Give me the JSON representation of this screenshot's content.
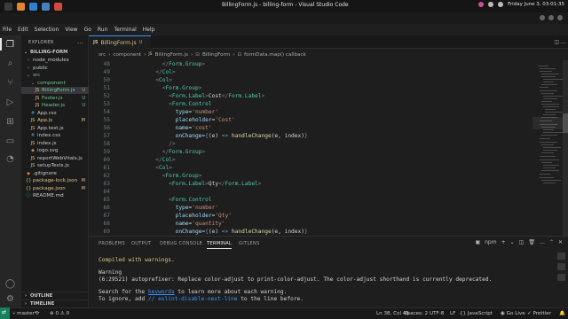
{
  "system": {
    "window_title": "BillingForm.js - billing-form - Visual Studio Code",
    "clock": "Friday June 3, 03:01:35"
  },
  "menu": [
    "File",
    "Edit",
    "Selection",
    "View",
    "Go",
    "Run",
    "Terminal",
    "Help"
  ],
  "explorer": {
    "title": "EXPLORER",
    "project": "BILLING-FORM",
    "items": [
      {
        "label": "node_modules",
        "kind": "folder",
        "depth": 1,
        "badge": "",
        "color": "#cccccc"
      },
      {
        "label": "public",
        "kind": "folder",
        "depth": 1,
        "badge": "",
        "color": "#cccccc"
      },
      {
        "label": "src",
        "kind": "folder-open",
        "depth": 1,
        "badge": "",
        "color": "#73c991"
      },
      {
        "label": "component",
        "kind": "folder-open",
        "depth": 2,
        "badge": "",
        "color": "#73c991"
      },
      {
        "label": "BillingForm.js",
        "kind": "js",
        "depth": 3,
        "badge": "U",
        "color": "#73c991",
        "selected": true
      },
      {
        "label": "Footer.js",
        "kind": "js",
        "depth": 3,
        "badge": "U",
        "color": "#73c991"
      },
      {
        "label": "Header.js",
        "kind": "js",
        "depth": 3,
        "badge": "U",
        "color": "#73c991"
      },
      {
        "label": "App.css",
        "kind": "css",
        "depth": 2,
        "badge": "",
        "color": "#cccccc"
      },
      {
        "label": "App.js",
        "kind": "js",
        "depth": 2,
        "badge": "M",
        "color": "#e2c08d"
      },
      {
        "label": "App.test.js",
        "kind": "js",
        "depth": 2,
        "badge": "",
        "color": "#cccccc"
      },
      {
        "label": "index.css",
        "kind": "css",
        "depth": 2,
        "badge": "",
        "color": "#cccccc"
      },
      {
        "label": "index.js",
        "kind": "js",
        "depth": 2,
        "badge": "",
        "color": "#cccccc"
      },
      {
        "label": "logo.svg",
        "kind": "svg",
        "depth": 2,
        "badge": "",
        "color": "#cccccc"
      },
      {
        "label": "reportWebVitals.js",
        "kind": "js",
        "depth": 2,
        "badge": "",
        "color": "#cccccc"
      },
      {
        "label": "setupTests.js",
        "kind": "js",
        "depth": 2,
        "badge": "",
        "color": "#cccccc"
      },
      {
        "label": ".gitignore",
        "kind": "git",
        "depth": 1,
        "badge": "",
        "color": "#cccccc"
      },
      {
        "label": "package-lock.json",
        "kind": "json",
        "depth": 1,
        "badge": "M",
        "color": "#e2c08d"
      },
      {
        "label": "package.json",
        "kind": "json",
        "depth": 1,
        "badge": "M",
        "color": "#e2c08d"
      },
      {
        "label": "README.md",
        "kind": "md",
        "depth": 1,
        "badge": "",
        "color": "#cccccc"
      }
    ],
    "outline": "OUTLINE",
    "timeline": "TIMELINE"
  },
  "editor": {
    "tab_label": "BillingForm.js",
    "tab_badge": "U",
    "breadcrumb": [
      "src",
      "component",
      "BillingForm.js",
      "BillingForm",
      "formData.map() callback"
    ],
    "lines": [
      {
        "n": "48",
        "indent": 12,
        "parts": [
          [
            "br",
            "</"
          ],
          [
            "tag",
            "Form.Group"
          ],
          [
            "br",
            ">"
          ]
        ]
      },
      {
        "n": "49",
        "indent": 10,
        "parts": [
          [
            "br",
            "</"
          ],
          [
            "tag",
            "Col"
          ],
          [
            "br",
            ">"
          ]
        ]
      },
      {
        "n": "50",
        "indent": 10,
        "parts": [
          [
            "br",
            "<"
          ],
          [
            "tag",
            "Col"
          ],
          [
            "br",
            ">"
          ]
        ]
      },
      {
        "n": "51",
        "indent": 12,
        "parts": [
          [
            "br",
            "<"
          ],
          [
            "tag",
            "Form.Group"
          ],
          [
            "br",
            ">"
          ]
        ]
      },
      {
        "n": "52",
        "indent": 14,
        "parts": [
          [
            "br",
            "<"
          ],
          [
            "tag",
            "Form.Label"
          ],
          [
            "br",
            ">"
          ],
          [
            "tx",
            "Cost"
          ],
          [
            "br",
            "</"
          ],
          [
            "tag",
            "Form.Label"
          ],
          [
            "br",
            ">"
          ]
        ]
      },
      {
        "n": "53",
        "indent": 14,
        "parts": [
          [
            "br",
            "<"
          ],
          [
            "tag",
            "Form.Control"
          ]
        ]
      },
      {
        "n": "54",
        "indent": 16,
        "parts": [
          [
            "at",
            "type"
          ],
          [
            "tx",
            "="
          ],
          [
            "str",
            "'number'"
          ]
        ]
      },
      {
        "n": "55",
        "indent": 16,
        "parts": [
          [
            "at",
            "placeholder"
          ],
          [
            "tx",
            "="
          ],
          [
            "str",
            "'Cost'"
          ]
        ]
      },
      {
        "n": "56",
        "indent": 16,
        "parts": [
          [
            "at",
            "name"
          ],
          [
            "tx",
            "="
          ],
          [
            "str",
            "'cost'"
          ]
        ]
      },
      {
        "n": "57",
        "indent": 16,
        "parts": [
          [
            "at",
            "onChange"
          ],
          [
            "tx",
            "="
          ],
          [
            "kw",
            "{"
          ],
          [
            "tx",
            "(e) "
          ],
          [
            "kw",
            "=>"
          ],
          [
            "tx",
            " "
          ],
          [
            "fn",
            "handleChange"
          ],
          [
            "tx",
            "(e, index)"
          ],
          [
            "kw",
            "}"
          ]
        ]
      },
      {
        "n": "58",
        "indent": 14,
        "parts": [
          [
            "br",
            "/>"
          ]
        ]
      },
      {
        "n": "59",
        "indent": 12,
        "parts": [
          [
            "br",
            "</"
          ],
          [
            "tag",
            "Form.Group"
          ],
          [
            "br",
            ">"
          ]
        ]
      },
      {
        "n": "60",
        "indent": 10,
        "parts": [
          [
            "br",
            "</"
          ],
          [
            "tag",
            "Col"
          ],
          [
            "br",
            ">"
          ]
        ]
      },
      {
        "n": "61",
        "indent": 10,
        "parts": [
          [
            "br",
            "<"
          ],
          [
            "tag",
            "Col"
          ],
          [
            "br",
            ">"
          ]
        ]
      },
      {
        "n": "62",
        "indent": 12,
        "parts": [
          [
            "br",
            "<"
          ],
          [
            "tag",
            "Form.Group"
          ],
          [
            "br",
            ">"
          ]
        ]
      },
      {
        "n": "63",
        "indent": 14,
        "parts": [
          [
            "br",
            "<"
          ],
          [
            "tag",
            "Form.Label"
          ],
          [
            "br",
            ">"
          ],
          [
            "tx",
            "Qty"
          ],
          [
            "br",
            "</"
          ],
          [
            "tag",
            "Form.Label"
          ],
          [
            "br",
            ">"
          ]
        ]
      },
      {
        "n": "64",
        "indent": 0,
        "parts": []
      },
      {
        "n": "65",
        "indent": 14,
        "parts": [
          [
            "br",
            "<"
          ],
          [
            "tag",
            "Form.Control"
          ]
        ]
      },
      {
        "n": "66",
        "indent": 16,
        "parts": [
          [
            "at",
            "type"
          ],
          [
            "tx",
            "="
          ],
          [
            "str",
            "'number'"
          ]
        ]
      },
      {
        "n": "67",
        "indent": 16,
        "parts": [
          [
            "at",
            "placeholder"
          ],
          [
            "tx",
            "="
          ],
          [
            "str",
            "'Qty'"
          ]
        ]
      },
      {
        "n": "68",
        "indent": 16,
        "parts": [
          [
            "at",
            "name"
          ],
          [
            "tx",
            "="
          ],
          [
            "str",
            "'quantity'"
          ]
        ]
      },
      {
        "n": "69",
        "indent": 16,
        "parts": [
          [
            "at",
            "onChange"
          ],
          [
            "tx",
            "="
          ],
          [
            "kw",
            "{"
          ],
          [
            "tx",
            "(e) "
          ],
          [
            "kw",
            "=>"
          ],
          [
            "tx",
            " "
          ],
          [
            "fn",
            "handleChange"
          ],
          [
            "tx",
            "(e, index)"
          ],
          [
            "kw",
            "}"
          ]
        ]
      }
    ]
  },
  "panel": {
    "tabs": [
      "PROBLEMS",
      "OUTPUT",
      "DEBUG CONSOLE",
      "TERMINAL",
      "GITLENS"
    ],
    "active_tab": "TERMINAL",
    "shell_label": "npm",
    "terminal": {
      "l1": "Compiled with warnings.",
      "l2": "Warning",
      "l3": "(6:29521) autoprefixer: Replace color-adjust to print-color-adjust. The color-adjust shorthand is currently deprecated.",
      "l4a": "Search for the ",
      "l4b": "keywords",
      "l4c": " to learn more about each warning.",
      "l5a": "To ignore, add ",
      "l5b": "// eslint-disable-next-line",
      "l5c": " to the line before."
    }
  },
  "statusbar": {
    "branch": "master*",
    "errors": "0",
    "warnings": "0",
    "position": "Ln 38, Col 45",
    "spaces": "Spaces: 2",
    "encoding": "UTF-8",
    "eol": "LF",
    "language": "JavaScript",
    "golive": "Go Live",
    "prettier": "Prettier"
  },
  "colors": {
    "accent": "#3794ff",
    "untracked": "#73c991",
    "modified": "#e2c08d",
    "remote": "#16825d"
  }
}
